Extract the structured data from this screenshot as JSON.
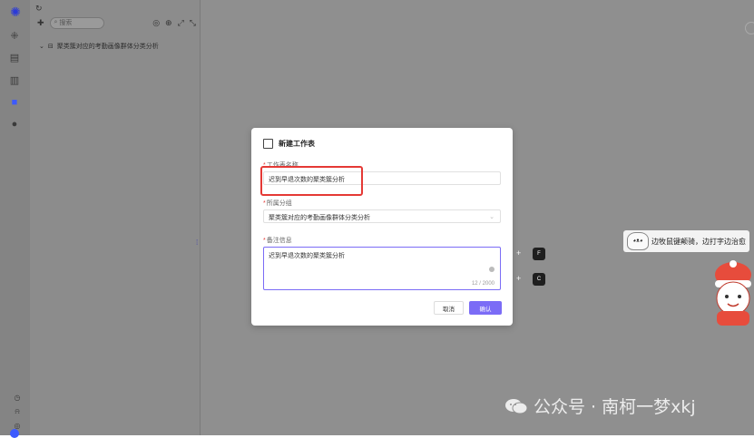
{
  "app": {
    "logo": "app-logo",
    "refresh_icon": "refresh-icon"
  },
  "rail": {
    "items": [
      {
        "icon": "grid-icon",
        "glyph": "⁜"
      },
      {
        "icon": "database-icon",
        "glyph": "▤"
      },
      {
        "icon": "chart-icon",
        "glyph": "▥"
      },
      {
        "icon": "folder-icon",
        "glyph": "■",
        "active": true
      },
      {
        "icon": "settings-icon",
        "glyph": "●"
      }
    ],
    "bottom": [
      {
        "icon": "clock-icon",
        "glyph": "◷"
      },
      {
        "icon": "bell-icon",
        "glyph": "⍾"
      },
      {
        "icon": "help-icon",
        "glyph": "◎"
      }
    ]
  },
  "tree": {
    "search_placeholder": "搜索",
    "node_label": "聚类簇对应的考勤画像群体分类分析"
  },
  "dialog": {
    "title": "新建工作表",
    "name_label": "工作表名称",
    "name_value": "迟到早退次数的聚类簇分析",
    "group_label": "所属分组",
    "group_value": "聚类簇对应的考勤画像群体分类分析",
    "note_label": "备注信息",
    "note_value": "迟到早退次数的聚类簇分析",
    "note_count": "12 / 2000",
    "cancel": "取消",
    "confirm": "确认"
  },
  "shortcuts": [
    {
      "plus": "+",
      "key": "F"
    },
    {
      "plus": "+",
      "key": "C"
    }
  ],
  "sticker": {
    "text": "边牧鼠键颠骑，边打字边治愈"
  },
  "watermark": {
    "text": "公众号 · 南柯一梦xkj"
  },
  "colors": {
    "accent": "#7b6cf6",
    "highlight": "#e53935",
    "overlay": "#8a8a8a"
  }
}
